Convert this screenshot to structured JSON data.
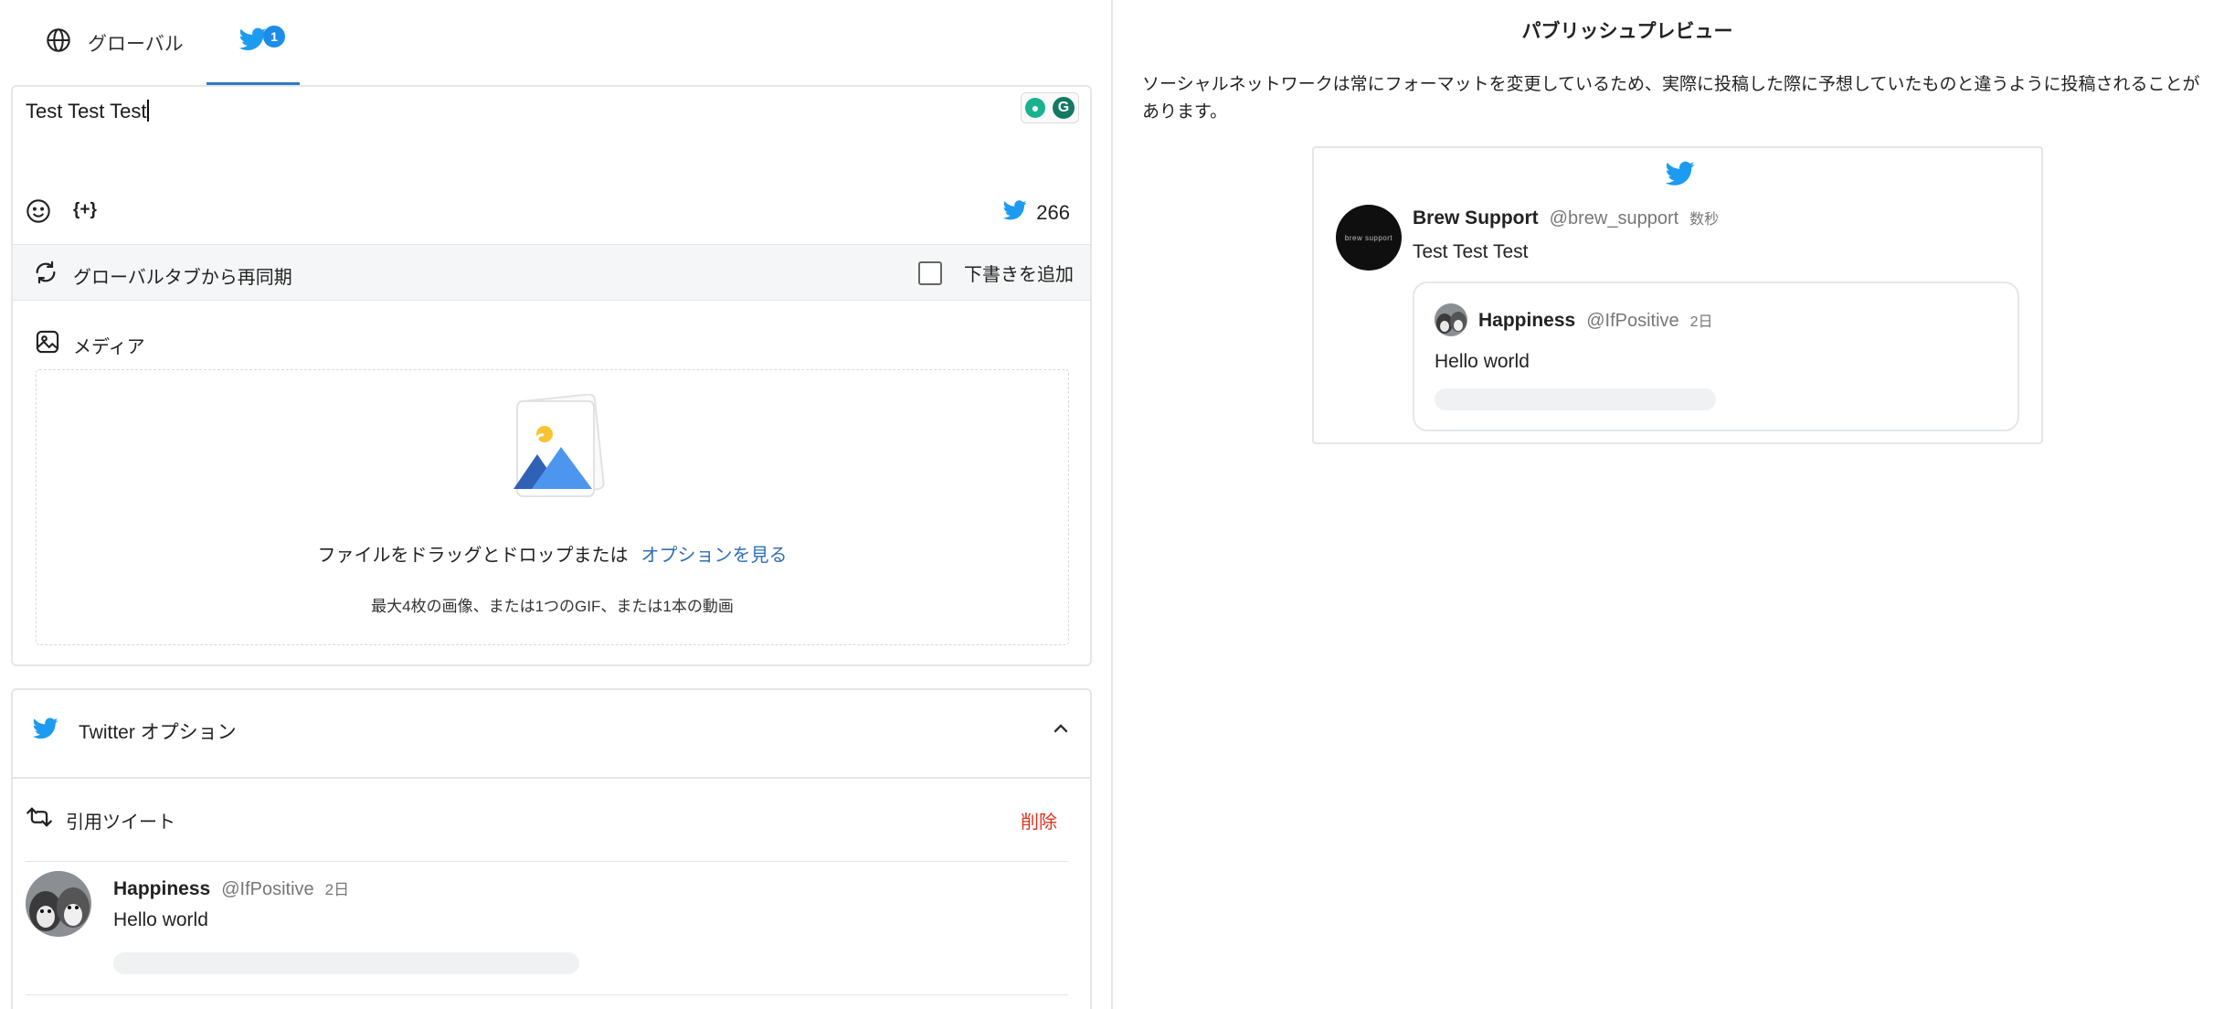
{
  "tabs": {
    "global_label": "グローバル",
    "twitter_badge": "1"
  },
  "composer": {
    "text": "Test Test Test",
    "counter": "266",
    "variable_token": "{+}"
  },
  "resync": {
    "label": "グローバルタブから再同期",
    "draft_label": "下書きを追加"
  },
  "media": {
    "title": "メディア",
    "drop_text": "ファイルをドラッグとドロップまたは",
    "drop_link": "オプションを見る",
    "limit_text": "最大4枚の画像、または1つのGIF、または1本の動画"
  },
  "twitter_options": {
    "title": "Twitter オプション",
    "quote_label": "引用ツイート",
    "delete_label": "削除",
    "quoted": {
      "name": "Happiness",
      "handle": "@IfPositive",
      "time": "2日",
      "text": "Hello world"
    }
  },
  "preview": {
    "title": "パブリッシュプレビュー",
    "description": "ソーシャルネットワークは常にフォーマットを変更しているため、実際に投稿した際に予想していたものと違うように投稿されることがあります。",
    "author": {
      "name": "Brew Support",
      "handle": "@brew_support",
      "time": "数秒",
      "avatar_text": "brew support"
    },
    "text": "Test Test Test",
    "quoted": {
      "name": "Happiness",
      "handle": "@IfPositive",
      "time": "2日",
      "text": "Hello world"
    }
  },
  "colors": {
    "twitter_blue": "#1d9bf0",
    "tab_underline": "#2f79c9",
    "link": "#2f6fb8",
    "delete": "#e0301e"
  }
}
